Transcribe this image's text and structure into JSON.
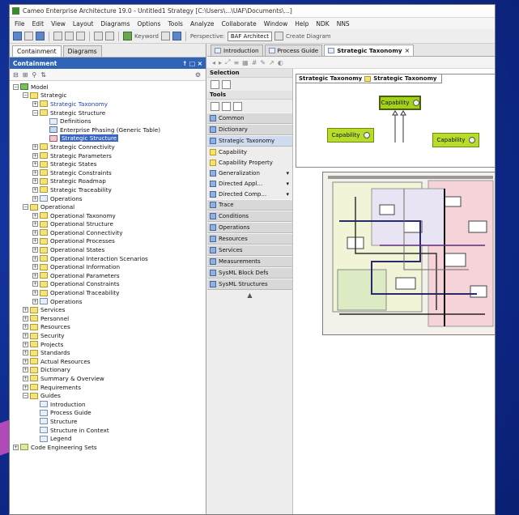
{
  "app": {
    "title": "Cameo Enterprise Architecture 19.0 - Untitled1 Strategy [C:\\Users\\...\\UAF\\Documents\\...]",
    "menu": [
      "File",
      "Edit",
      "View",
      "Layout",
      "Diagrams",
      "Options",
      "Tools",
      "Analyze",
      "Collaborate",
      "Window",
      "Help",
      "NDK",
      "NNS"
    ],
    "toolbar": {
      "keyword_label": "Keyword",
      "perspective_label": "Perspective:",
      "perspective_value": "BAF Architect",
      "create_label": "Create Diagram"
    }
  },
  "left_panel": {
    "tabs": [
      "Containment",
      "Diagrams"
    ],
    "header": "Containment",
    "header_controls": "↑ □ ×",
    "tree": [
      {
        "label": "Model",
        "depth": 0,
        "exp": "−",
        "icon": "model"
      },
      {
        "label": "Strategic",
        "depth": 1,
        "exp": "−",
        "icon": "pkg"
      },
      {
        "label": "Strategic Taxonomy",
        "depth": 2,
        "exp": "+",
        "icon": "pkg",
        "style": "blue"
      },
      {
        "label": "Strategic Structure",
        "depth": 2,
        "exp": "−",
        "icon": "pkg"
      },
      {
        "label": "Definitions",
        "depth": 3,
        "exp": "",
        "icon": "doc"
      },
      {
        "label": "Enterprise Phasing (Generic Table)",
        "depth": 3,
        "exp": "",
        "icon": "table"
      },
      {
        "label": "Strategic Structure",
        "depth": 3,
        "exp": "",
        "icon": "diag",
        "style": "sel"
      },
      {
        "label": "Strategic Connectivity",
        "depth": 2,
        "exp": "+",
        "icon": "pkg"
      },
      {
        "label": "Strategic Parameters",
        "depth": 2,
        "exp": "+",
        "icon": "pkg"
      },
      {
        "label": "Strategic States",
        "depth": 2,
        "exp": "+",
        "icon": "pkg"
      },
      {
        "label": "Strategic Constraints",
        "depth": 2,
        "exp": "+",
        "icon": "pkg"
      },
      {
        "label": "Strategic Roadmap",
        "depth": 2,
        "exp": "+",
        "icon": "pkg"
      },
      {
        "label": "Strategic Traceability",
        "depth": 2,
        "exp": "+",
        "icon": "pkg"
      },
      {
        "label": "Operations",
        "depth": 2,
        "exp": "+",
        "icon": "doc"
      },
      {
        "label": "Operational",
        "depth": 1,
        "exp": "−",
        "icon": "pkg"
      },
      {
        "label": "Operational Taxonomy",
        "depth": 2,
        "exp": "+",
        "icon": "pkg"
      },
      {
        "label": "Operational Structure",
        "depth": 2,
        "exp": "+",
        "icon": "pkg"
      },
      {
        "label": "Operational Connectivity",
        "depth": 2,
        "exp": "+",
        "icon": "pkg"
      },
      {
        "label": "Operational Processes",
        "depth": 2,
        "exp": "+",
        "icon": "pkg"
      },
      {
        "label": "Operational States",
        "depth": 2,
        "exp": "+",
        "icon": "pkg"
      },
      {
        "label": "Operational Interaction Scenarios",
        "depth": 2,
        "exp": "+",
        "icon": "pkg"
      },
      {
        "label": "Operational Information",
        "depth": 2,
        "exp": "+",
        "icon": "pkg"
      },
      {
        "label": "Operational Parameters",
        "depth": 2,
        "exp": "+",
        "icon": "pkg"
      },
      {
        "label": "Operational Constraints",
        "depth": 2,
        "exp": "+",
        "icon": "pkg"
      },
      {
        "label": "Operational Traceability",
        "depth": 2,
        "exp": "+",
        "icon": "pkg"
      },
      {
        "label": "Operations",
        "depth": 2,
        "exp": "+",
        "icon": "doc"
      },
      {
        "label": "Services",
        "depth": 1,
        "exp": "+",
        "icon": "pkg"
      },
      {
        "label": "Personnel",
        "depth": 1,
        "exp": "+",
        "icon": "pkg"
      },
      {
        "label": "Resources",
        "depth": 1,
        "exp": "+",
        "icon": "pkg"
      },
      {
        "label": "Security",
        "depth": 1,
        "exp": "+",
        "icon": "pkg"
      },
      {
        "label": "Projects",
        "depth": 1,
        "exp": "+",
        "icon": "pkg"
      },
      {
        "label": "Standards",
        "depth": 1,
        "exp": "+",
        "icon": "pkg"
      },
      {
        "label": "Actual Resources",
        "depth": 1,
        "exp": "+",
        "icon": "pkg"
      },
      {
        "label": "Dictionary",
        "depth": 1,
        "exp": "+",
        "icon": "pkg"
      },
      {
        "label": "Summary & Overview",
        "depth": 1,
        "exp": "+",
        "icon": "pkg"
      },
      {
        "label": "Requirements",
        "depth": 1,
        "exp": "+",
        "icon": "pkg"
      },
      {
        "label": "Guides",
        "depth": 1,
        "exp": "−",
        "icon": "pkg"
      },
      {
        "label": "Introduction",
        "depth": 2,
        "exp": "",
        "icon": "doc"
      },
      {
        "label": "Process Guide",
        "depth": 2,
        "exp": "",
        "icon": "doc"
      },
      {
        "label": "Structure",
        "depth": 2,
        "exp": "",
        "icon": "doc"
      },
      {
        "label": "Structure in Context",
        "depth": 2,
        "exp": "",
        "icon": "doc"
      },
      {
        "label": "Legend",
        "depth": 2,
        "exp": "",
        "icon": "doc"
      },
      {
        "label": "Code Engineering Sets",
        "depth": 0,
        "exp": "+",
        "icon": "pkg-green"
      }
    ]
  },
  "right_panel": {
    "tabs": [
      {
        "label": "Introduction",
        "active": false
      },
      {
        "label": "Process Guide",
        "active": false
      },
      {
        "label": "Strategic Taxonomy",
        "active": true
      }
    ],
    "tab_close": "×",
    "palette": {
      "header": "Selection",
      "tools_header": "Tools",
      "items": [
        {
          "label": "Common",
          "group": true
        },
        {
          "label": "Dictionary",
          "group": true
        },
        {
          "label": "Strategic Taxonomy",
          "group": true,
          "hl": true
        },
        {
          "label": "Capability",
          "icon": "y"
        },
        {
          "label": "Capability Property",
          "icon": "y"
        },
        {
          "label": "Generalization",
          "icon": "b",
          "more": "▾"
        },
        {
          "label": "Directed Appl...",
          "icon": "b",
          "more": "▾"
        },
        {
          "label": "Directed Comp...",
          "icon": "b",
          "more": "▾"
        },
        {
          "label": "Trace",
          "group": true
        },
        {
          "label": "Conditions",
          "group": true
        },
        {
          "label": "Operations",
          "group": true
        },
        {
          "label": "Resources",
          "group": true
        },
        {
          "label": "Services",
          "group": true
        },
        {
          "label": "Measurements",
          "group": true
        },
        {
          "label": "SysML Block Defs",
          "group": true
        },
        {
          "label": "SysML Structures",
          "group": true
        }
      ],
      "more": "▲"
    },
    "diagram": {
      "frame_label": "Strategic Taxonomy",
      "frame_label_2": "Strategic Taxonomy",
      "caps": [
        "Capability",
        "Capability",
        "Capability"
      ]
    }
  }
}
